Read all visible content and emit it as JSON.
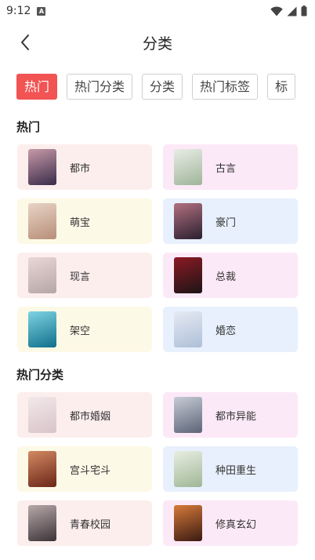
{
  "status": {
    "time": "9:12"
  },
  "header": {
    "title": "分类"
  },
  "tabs": [
    "热门",
    "热门分类",
    "分类",
    "热门标签",
    "标"
  ],
  "sections": [
    {
      "title": "热门",
      "items": [
        {
          "label": "都市",
          "bg": "pink",
          "cover": [
            "#3a2b4a",
            "#c79aa8"
          ]
        },
        {
          "label": "古言",
          "bg": "magenta",
          "cover": [
            "#9fb59a",
            "#e9ece6"
          ]
        },
        {
          "label": "萌宝",
          "bg": "yellow",
          "cover": [
            "#b88e78",
            "#e8d4c6"
          ]
        },
        {
          "label": "豪门",
          "bg": "blue",
          "cover": [
            "#2a2030",
            "#b2707f"
          ]
        },
        {
          "label": "现言",
          "bg": "pink",
          "cover": [
            "#b6a6a8",
            "#ead7d6"
          ]
        },
        {
          "label": "总裁",
          "bg": "magenta",
          "cover": [
            "#1c1416",
            "#8c1a24"
          ]
        },
        {
          "label": "架空",
          "bg": "yellow",
          "cover": [
            "#0f6f8a",
            "#7fd3e3"
          ]
        },
        {
          "label": "婚恋",
          "bg": "blue",
          "cover": [
            "#aebfd8",
            "#e6eaf3"
          ]
        }
      ]
    },
    {
      "title": "热门分类",
      "items": [
        {
          "label": "都市婚姻",
          "bg": "pink",
          "cover": [
            "#d8c4c8",
            "#f2e8ea"
          ]
        },
        {
          "label": "都市异能",
          "bg": "magenta",
          "cover": [
            "#5c6476",
            "#c6cbd6"
          ]
        },
        {
          "label": "宫斗宅斗",
          "bg": "yellow",
          "cover": [
            "#6b2618",
            "#d28a62"
          ]
        },
        {
          "label": "种田重生",
          "bg": "blue",
          "cover": [
            "#9fb796",
            "#e8eee2"
          ]
        },
        {
          "label": "青春校园",
          "bg": "pink",
          "cover": [
            "#3c3438",
            "#b8a8aa"
          ]
        },
        {
          "label": "修真玄幻",
          "bg": "magenta",
          "cover": [
            "#3a1a12",
            "#d67a3a"
          ]
        }
      ]
    }
  ]
}
